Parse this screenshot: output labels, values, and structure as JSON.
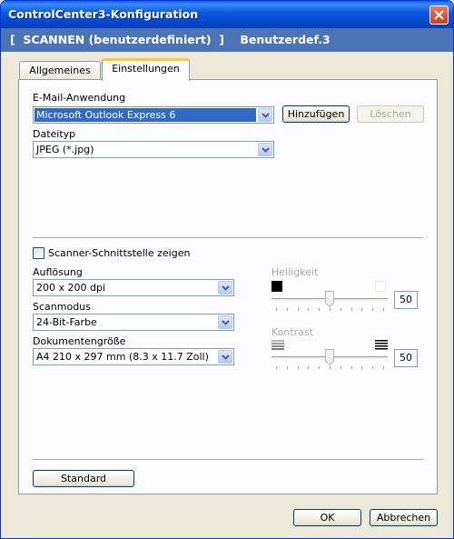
{
  "window": {
    "title": "ControlCenter3-Konfiguration"
  },
  "header": {
    "title": "[  SCANNEN (benutzerdefiniert)  ]    Benutzerdef.3"
  },
  "tabs": [
    {
      "label": "Allgemeines",
      "active": false
    },
    {
      "label": "Einstellungen",
      "active": true
    }
  ],
  "email": {
    "label": "E-Mail-Anwendung",
    "value": "Microsoft Outlook Express 6",
    "add_label": "Hinzufügen",
    "delete_label": "Löschen"
  },
  "filetype": {
    "label": "Dateityp",
    "value": "JPEG (*.jpg)"
  },
  "scanner_interface": {
    "label": "Scanner-Schnittstelle zeigen",
    "checked": false
  },
  "resolution": {
    "label": "Auflösung",
    "value": "200 x 200 dpi"
  },
  "scanmode": {
    "label": "Scanmodus",
    "value": "24-Bit-Farbe"
  },
  "docsize": {
    "label": "Dokumentengröße",
    "value": "A4 210 x 297 mm (8.3 x 11.7 Zoll)"
  },
  "brightness": {
    "label": "Helligkeit",
    "value": "50",
    "level": 0.5
  },
  "contrast": {
    "label": "Kontrast",
    "value": "50",
    "level": 0.5
  },
  "footer": {
    "default_label": "Standard",
    "ok_label": "OK",
    "cancel_label": "Abbrechen"
  },
  "colors": {
    "title_blue": "#0a55e0",
    "header_band": "#4a74b7",
    "selection": "#316ac5",
    "active_tab": "#ffc83c"
  }
}
